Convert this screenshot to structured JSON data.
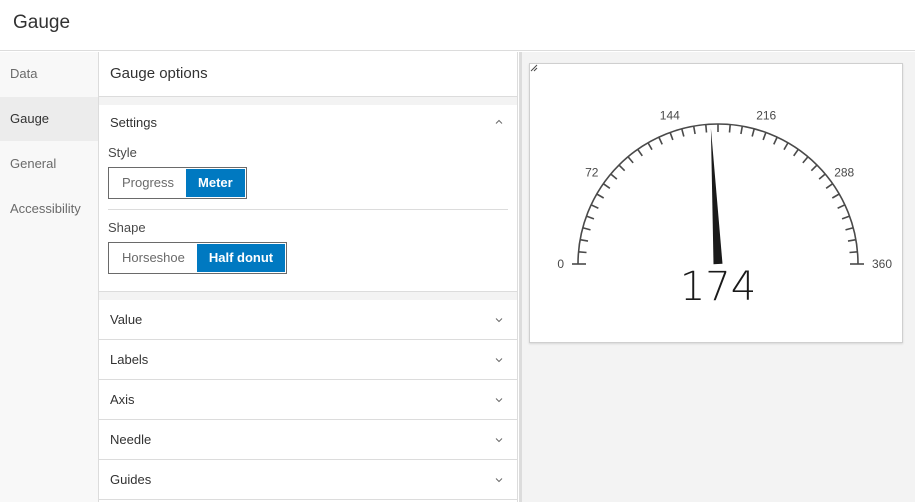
{
  "app": {
    "title": "Gauge"
  },
  "tabs": [
    {
      "label": "Data",
      "active": false
    },
    {
      "label": "Gauge",
      "active": true
    },
    {
      "label": "General",
      "active": false
    },
    {
      "label": "Accessibility",
      "active": false
    }
  ],
  "panel": {
    "title": "Gauge options",
    "settings": {
      "label": "Settings",
      "expanded": true,
      "style": {
        "label": "Style",
        "options": [
          "Progress",
          "Meter"
        ],
        "selected": "Meter"
      },
      "shape": {
        "label": "Shape",
        "options": [
          "Horseshoe",
          "Half donut"
        ],
        "selected": "Half donut"
      }
    },
    "sections": [
      "Value",
      "Labels",
      "Axis",
      "Needle",
      "Guides"
    ]
  },
  "gauge": {
    "value": 174,
    "value_label": "174",
    "min": 0,
    "max": 360,
    "tick_labels": [
      "0",
      "72",
      "144",
      "216",
      "288",
      "360"
    ],
    "tick_count": 36,
    "needle_color": "#1a1a1a",
    "arc_color": "#4a4a4a"
  },
  "colors": {
    "accent": "#0079c1"
  },
  "icons": {
    "chevron_up": "chevron-up-icon",
    "chevron_down": "chevron-down-icon",
    "resize": "resize-handle-icon"
  }
}
